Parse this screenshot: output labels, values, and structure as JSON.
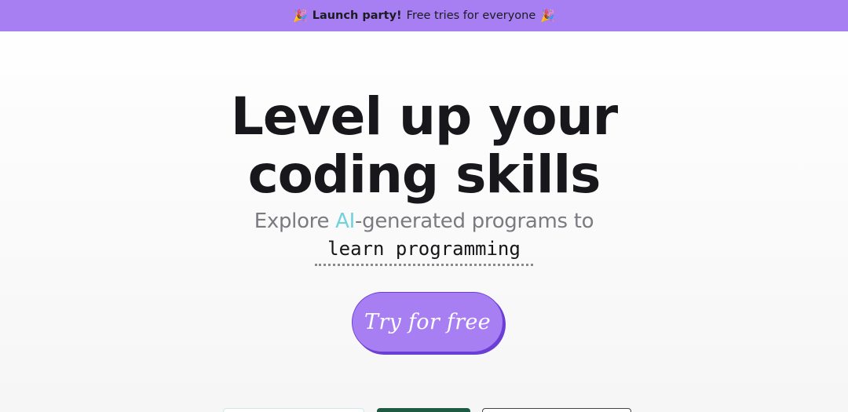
{
  "banner": {
    "emoji_left": "🎉",
    "strong_text": "Launch party!",
    "text": "Free tries for everyone",
    "emoji_right": "🎉",
    "background": "#a77ff3"
  },
  "hero": {
    "title_line1": "Level up your",
    "title_line2": "coding skills",
    "subtitle_before": "Explore ",
    "subtitle_accent": "AI",
    "subtitle_after": "-generated programs to",
    "typed_text": "learn programming"
  },
  "cta": {
    "label": "Try for free",
    "color": "#a77ff3",
    "border_color": "#6b3fd6"
  },
  "colors": {
    "accent_ai": "#6fd3d9",
    "title": "#17171c",
    "subtitle": "#7a7a80",
    "card_2": "#1d5b44"
  }
}
